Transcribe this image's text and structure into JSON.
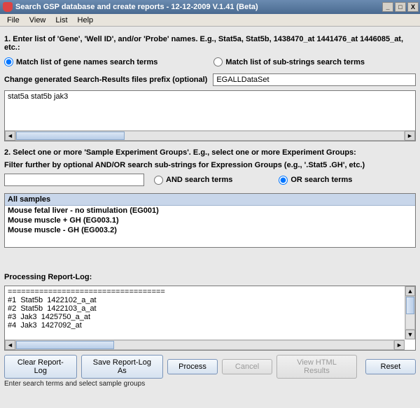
{
  "window": {
    "title": "Search GSP database and create reports - 12-12-2009 V.1.41 (Beta)"
  },
  "menubar": [
    "File",
    "View",
    "List",
    "Help"
  ],
  "section1": {
    "label": "1. Enter list of 'Gene', 'Well ID', and/or 'Probe' names. E.g., Stat5a, Stat5b, 1438470_at 1441476_at 1446085_at, etc.:",
    "radio_gene": "Match list of gene names search terms",
    "radio_sub": "Match list of sub-strings search terms",
    "prefix_label": "Change generated Search-Results files prefix (optional)",
    "prefix_value": "EGALLDataSet",
    "search_terms": "stat5a stat5b jak3"
  },
  "section2": {
    "label": "2. Select one or more 'Sample Experiment Groups'. E.g., select one or more Experiment Groups:",
    "filter_label": "Filter further by optional AND/OR search sub-strings for Expression Groups (e.g., '.Stat5 .GH', etc.)",
    "filter_value": "",
    "radio_and": "AND search terms",
    "radio_or": "OR search terms",
    "list_header": "All samples",
    "items": [
      "Mouse fetal liver - no stimulation (EG001)",
      "Mouse muscle + GH (EG003.1)",
      "Mouse muscle - GH (EG003.2)"
    ]
  },
  "report": {
    "label": "Processing Report-Log:",
    "lines": [
      "===================================",
      "#1  Stat5b  1422102_a_at",
      "#2  Stat5b  1422103_a_at",
      "#3  Jak3  1425750_a_at",
      "#4  Jak3  1427092_at"
    ]
  },
  "buttons": {
    "clear": "Clear Report-Log",
    "save": "Save Report-Log As",
    "process": "Process",
    "cancel": "Cancel",
    "view": "View HTML Results",
    "reset": "Reset"
  },
  "status": "Enter search terms and select sample groups"
}
